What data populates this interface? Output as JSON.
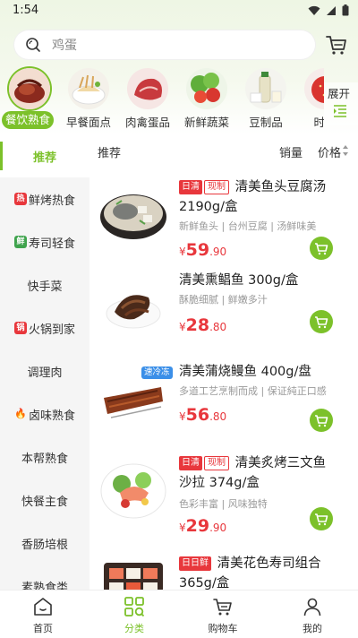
{
  "status": {
    "time": "1:54"
  },
  "search": {
    "placeholder": "鸡蛋"
  },
  "categories": [
    {
      "label": "餐饮熟食",
      "active": true
    },
    {
      "label": "早餐面点"
    },
    {
      "label": "肉禽蛋品"
    },
    {
      "label": "新鲜蔬菜"
    },
    {
      "label": "豆制品"
    },
    {
      "label": "时令"
    }
  ],
  "expand": {
    "label": "展开"
  },
  "sidebar": [
    {
      "label": "推荐",
      "active": true
    },
    {
      "label": "鲜烤热食",
      "badge": "热",
      "badge_color": "#e8373c"
    },
    {
      "label": "寿司轻食",
      "badge": "鲜",
      "badge_color": "#3fa34d"
    },
    {
      "label": "快手菜"
    },
    {
      "label": "火锅到家",
      "badge": "锅",
      "badge_color": "#e8373c"
    },
    {
      "label": "调理肉"
    },
    {
      "label": "卤味熟食",
      "badge": "🔥",
      "badge_color": "#ff6a2b"
    },
    {
      "label": "本帮熟食"
    },
    {
      "label": "快餐主食"
    },
    {
      "label": "香肠培根"
    },
    {
      "label": "素熟食类"
    }
  ],
  "sort": {
    "recommend": "推荐",
    "sales": "销量",
    "price": "价格"
  },
  "products": [
    {
      "tags": [
        "日清",
        "现制"
      ],
      "title": "清美鱼头豆腐汤2190g/盒",
      "desc": "新鲜鱼头 | 台州豆腐 | 汤鲜味美",
      "price_cur": "¥",
      "price_int": "59",
      "price_dec": ".90"
    },
    {
      "tags": [],
      "title": "清美熏鲳鱼 300g/盒",
      "desc": "酥脆细腻 | 鲜嫩多汁",
      "price_cur": "¥",
      "price_int": "28",
      "price_dec": ".80"
    },
    {
      "tags": [],
      "floating_tag": "速冷冻",
      "title": "清美蒲烧鳗鱼 400g/盘",
      "desc": "多道工艺烹制而成 | 保证純正口感",
      "price_cur": "¥",
      "price_int": "56",
      "price_dec": ".80"
    },
    {
      "tags": [
        "日清",
        "现制"
      ],
      "title": "清美炙烤三文鱼沙拉 374g/盒",
      "desc": "色彩丰富 | 风味独特",
      "price_cur": "¥",
      "price_int": "29",
      "price_dec": ".90"
    },
    {
      "tags": [
        "日日鲜"
      ],
      "title": "清美花色寿司组合365g/盒",
      "desc": "",
      "price_cur": "",
      "price_int": "",
      "price_dec": ""
    }
  ],
  "nav": [
    {
      "label": "首页"
    },
    {
      "label": "分类",
      "active": true
    },
    {
      "label": "购物车"
    },
    {
      "label": "我的"
    }
  ],
  "colors": {
    "accent": "#7cc12a",
    "price": "#e8373c"
  }
}
